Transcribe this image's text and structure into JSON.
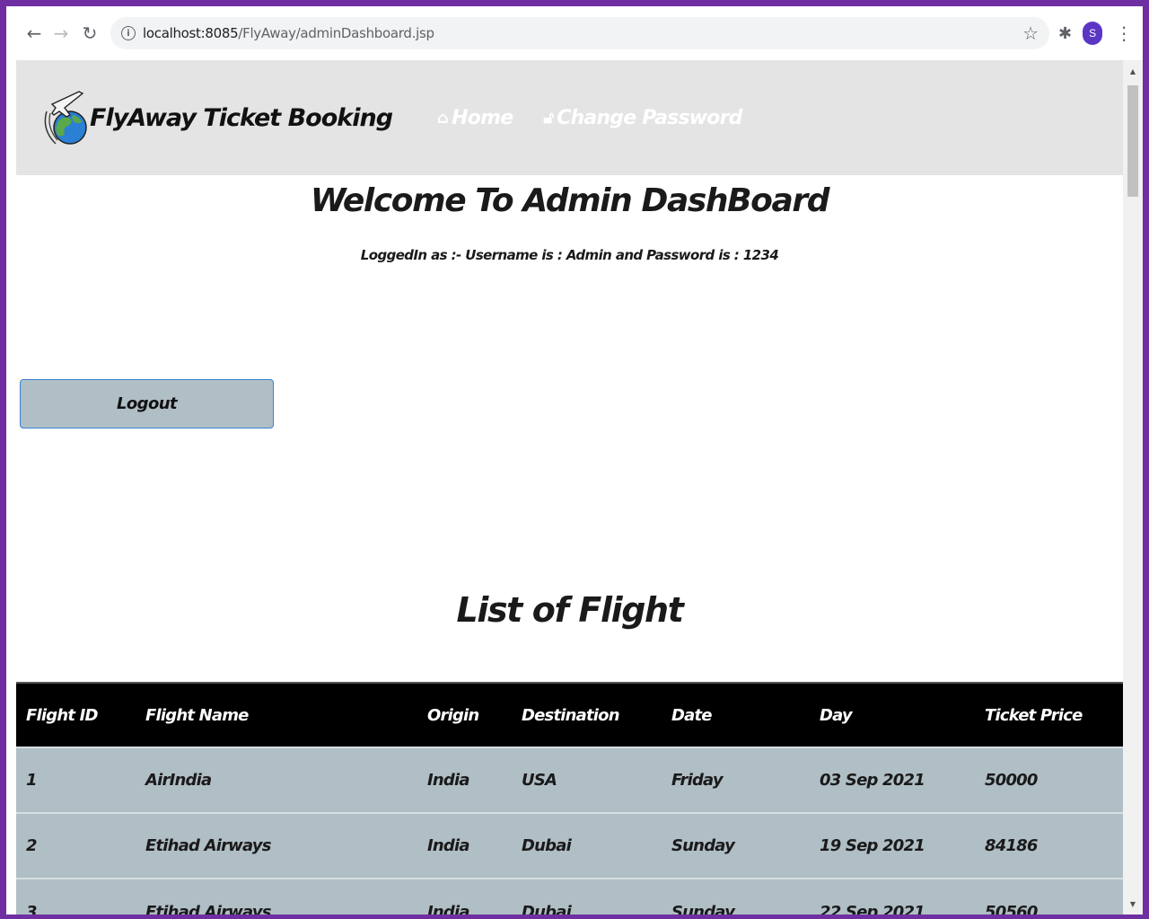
{
  "browser": {
    "url_host": "localhost:8085",
    "url_path": "/FlyAway/adminDashboard.jsp",
    "avatar_letter": "S",
    "icons": [
      "back-icon",
      "forward-icon",
      "reload-icon",
      "info-icon",
      "star-icon",
      "extensions-icon",
      "menu-icon"
    ]
  },
  "header": {
    "brand": "FlyAway Ticket Booking",
    "nav": {
      "home": "Home",
      "change_password": "Change Password"
    }
  },
  "main": {
    "welcome_title": "Welcome To Admin DashBoard",
    "login_info": "LoggedIn as :- Username is : Admin and Password is : 1234",
    "logout_label": "Logout",
    "list_title": "List of Flight"
  },
  "table": {
    "columns": [
      "Flight ID",
      "Flight Name",
      "Origin",
      "Destination",
      "Date",
      "Day",
      "Ticket Price"
    ],
    "rows": [
      [
        "1",
        "AirIndia",
        "India",
        "USA",
        "Friday",
        "03 Sep 2021",
        "50000"
      ],
      [
        "2",
        "Etihad Airways",
        "India",
        "Dubai",
        "Sunday",
        "19 Sep 2021",
        "84186"
      ],
      [
        "3",
        "Etihad Airways",
        "India",
        "Dubai",
        "Sunday",
        "22 Sep 2021",
        "50560"
      ]
    ]
  },
  "colors": {
    "frame": "#6f2fa3",
    "header_bg": "#e4e4e4",
    "table_head_bg": "#000000",
    "table_row_bg": "#b0bec5",
    "button_border": "#3b82d6"
  }
}
